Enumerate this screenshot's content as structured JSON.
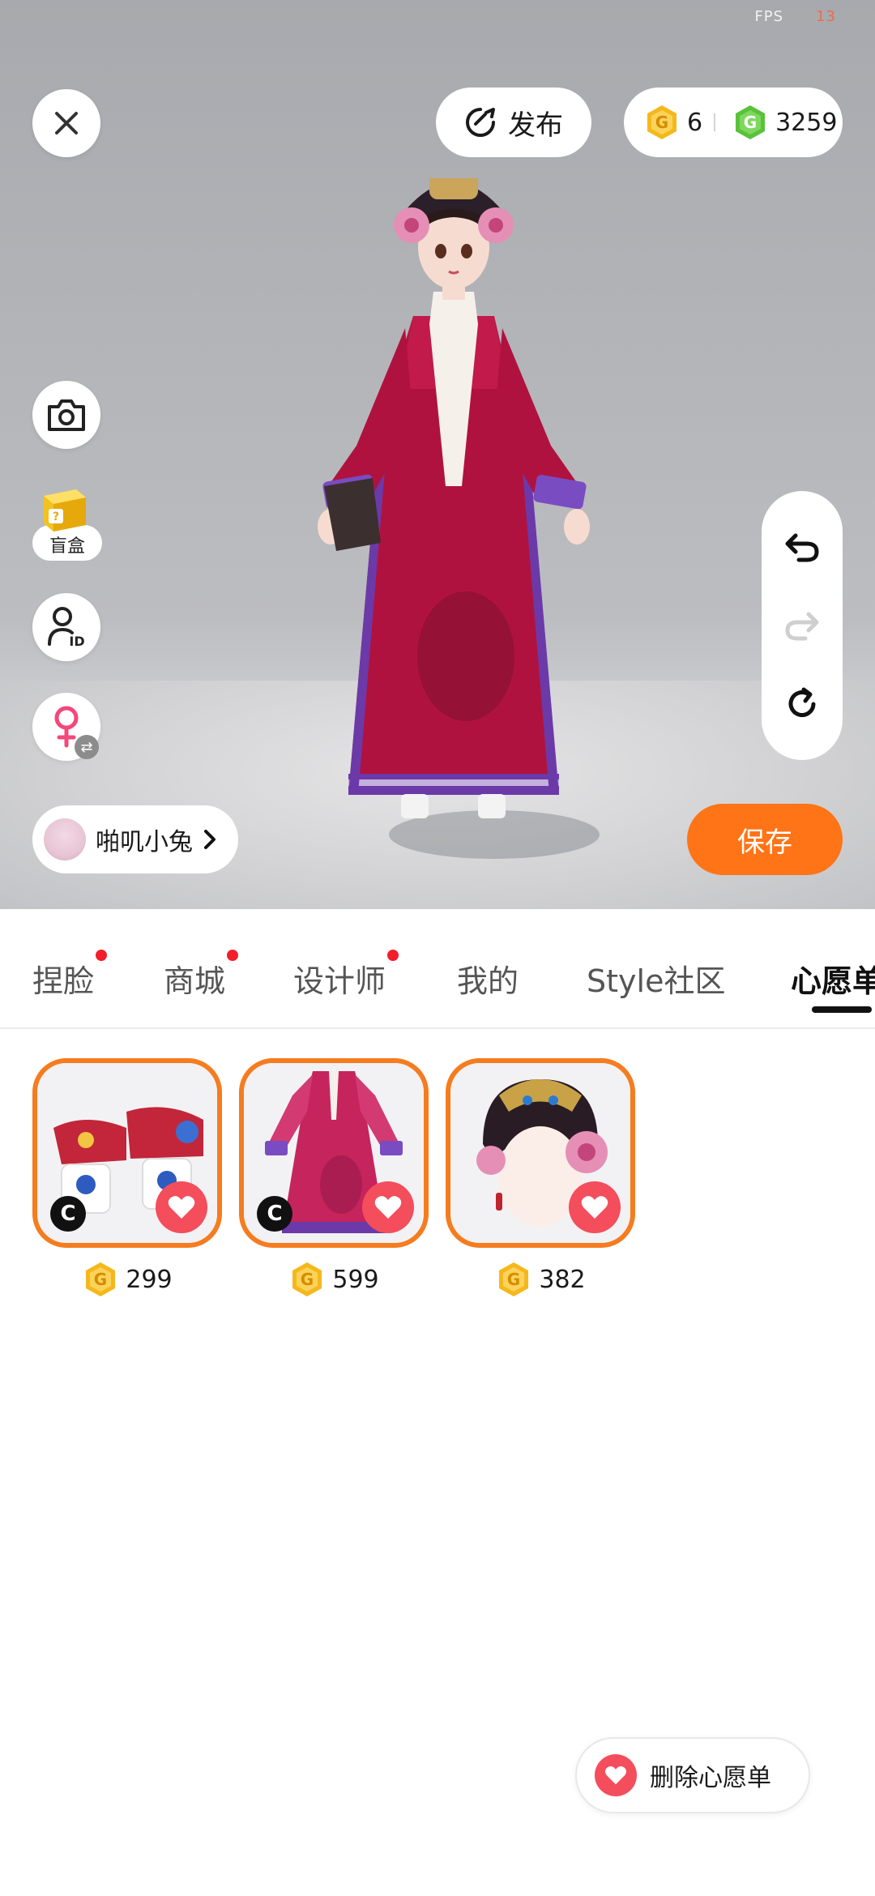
{
  "status": {
    "fps_label": "FPS",
    "fps_value": "13"
  },
  "top_bar": {
    "publish_label": "发布",
    "currency_1": "6",
    "currency_2": "3259"
  },
  "left_tools": {
    "blindbox_label": "盲盒"
  },
  "outfit": {
    "name": "啪叽小兔"
  },
  "save_label": "保存",
  "tabs": [
    {
      "label": "捏脸",
      "has_dot": true
    },
    {
      "label": "商城",
      "has_dot": true
    },
    {
      "label": "设计师",
      "has_dot": true
    },
    {
      "label": "我的",
      "has_dot": false
    },
    {
      "label": "Style社区",
      "has_dot": false
    },
    {
      "label": "心愿单",
      "active": true
    }
  ],
  "wishlist_items": [
    {
      "name": "shoes",
      "price": "299",
      "c_badge": "C",
      "icon": "platform-shoes"
    },
    {
      "name": "robe",
      "price": "599",
      "c_badge": "C",
      "icon": "qing-robe"
    },
    {
      "name": "headdress",
      "price": "382",
      "icon": "flower-headdress"
    }
  ],
  "delete_wishlist_label": "删除心愿单",
  "colors": {
    "accent": "#ff7417",
    "heart": "#f44d5c",
    "coin_gold": "#f5b81c",
    "coin_green": "#58c23b",
    "dot_red": "#f21f2b"
  }
}
